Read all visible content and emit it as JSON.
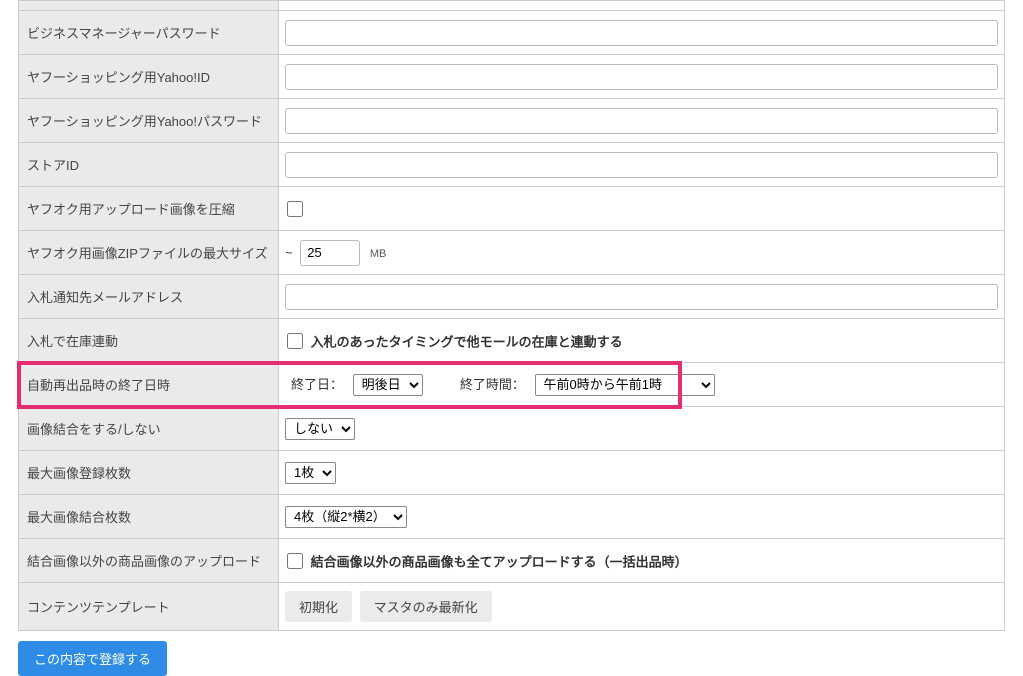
{
  "rows": {
    "bm_password": {
      "label": "ビジネスマネージャーパスワード",
      "value": ""
    },
    "yahoo_id": {
      "label": "ヤフーショッピング用Yahoo!ID",
      "value": ""
    },
    "yahoo_password": {
      "label": "ヤフーショッピング用Yahoo!パスワード",
      "value": ""
    },
    "store_id": {
      "label": "ストアID",
      "value": ""
    },
    "compress_image": {
      "label": "ヤフオク用アップロード画像を圧縮",
      "checked": false
    },
    "zip_max_size": {
      "label": "ヤフオク用画像ZIPファイルの最大サイズ",
      "tilde": "~",
      "value": "25",
      "unit": "MB"
    },
    "bid_notify_email": {
      "label": "入札通知先メールアドレス",
      "value": ""
    },
    "bid_stock_link": {
      "label": "入札で在庫連動",
      "checkbox_label": "入札のあったタイミングで他モールの在庫と連動する",
      "checked": false
    },
    "auto_relist_end": {
      "label": "自動再出品時の終了日時",
      "end_date_label": "終了日：",
      "end_date_value": "明後日",
      "end_time_label": "終了時間：",
      "end_time_value": "午前0時から午前1時"
    },
    "image_merge": {
      "label": "画像結合をする/しない",
      "value": "しない"
    },
    "max_image_count": {
      "label": "最大画像登録枚数",
      "value": "1枚"
    },
    "max_merge_count": {
      "label": "最大画像結合枚数",
      "value": "4枚（縦2*横2）"
    },
    "upload_non_merged": {
      "label": "結合画像以外の商品画像のアップロード",
      "checkbox_label": "結合画像以外の商品画像も全てアップロードする（一括出品時）",
      "checked": false
    },
    "content_template": {
      "label": "コンテンツテンプレート",
      "init_button": "初期化",
      "update_button": "マスタのみ最新化"
    }
  },
  "submit_button": "この内容で登録する"
}
